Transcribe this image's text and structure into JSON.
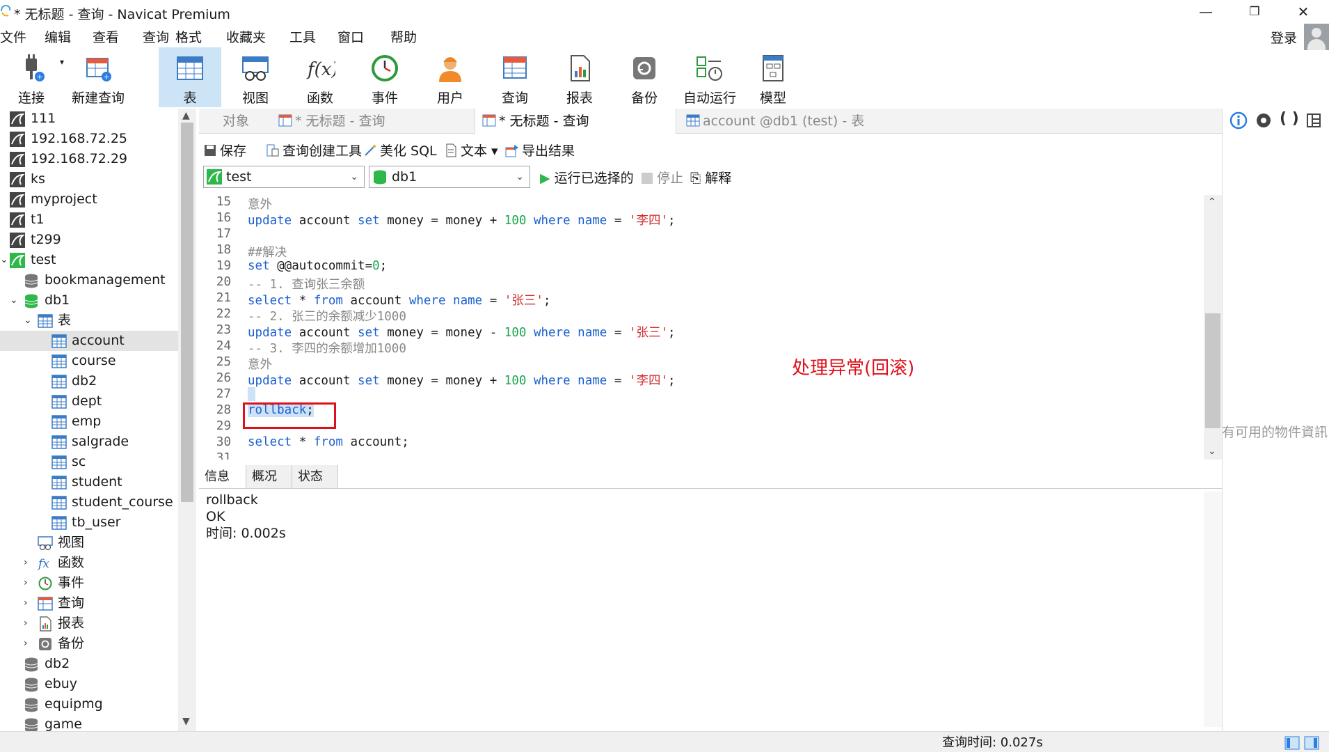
{
  "window": {
    "title": "* 无标题 - 查询 - Navicat Premium",
    "minimize": "—",
    "restore": "❐",
    "close": "✕"
  },
  "menu": [
    "文件",
    "编辑",
    "查看",
    "查询",
    "格式",
    "收藏夹",
    "工具",
    "窗口",
    "帮助"
  ],
  "login": "登录",
  "toolbar": [
    {
      "label": "连接",
      "icon": "plug-icon"
    },
    {
      "label": "新建查询",
      "icon": "new-query-icon"
    },
    {
      "label": "表",
      "icon": "table-icon"
    },
    {
      "label": "视图",
      "icon": "view-icon"
    },
    {
      "label": "函数",
      "icon": "function-icon"
    },
    {
      "label": "事件",
      "icon": "event-clock-icon"
    },
    {
      "label": "用户",
      "icon": "user-icon"
    },
    {
      "label": "查询",
      "icon": "query-icon"
    },
    {
      "label": "报表",
      "icon": "report-icon"
    },
    {
      "label": "备份",
      "icon": "backup-icon"
    },
    {
      "label": "自动运行",
      "icon": "automation-icon"
    },
    {
      "label": "模型",
      "icon": "model-icon"
    }
  ],
  "tree": [
    {
      "label": "111",
      "type": "conn"
    },
    {
      "label": "192.168.72.25",
      "type": "conn"
    },
    {
      "label": "192.168.72.29",
      "type": "conn"
    },
    {
      "label": "ks",
      "type": "conn"
    },
    {
      "label": "myproject",
      "type": "conn"
    },
    {
      "label": "t1",
      "type": "conn"
    },
    {
      "label": "t299",
      "type": "conn"
    },
    {
      "label": "test",
      "type": "conn-open"
    },
    {
      "label": "bookmanagement",
      "type": "db"
    },
    {
      "label": "db1",
      "type": "db-open"
    },
    {
      "label": "表",
      "type": "folder-table"
    },
    {
      "label": "account",
      "type": "table"
    },
    {
      "label": "course",
      "type": "table"
    },
    {
      "label": "db2",
      "type": "table"
    },
    {
      "label": "dept",
      "type": "table"
    },
    {
      "label": "emp",
      "type": "table"
    },
    {
      "label": "salgrade",
      "type": "table"
    },
    {
      "label": "sc",
      "type": "table"
    },
    {
      "label": "student",
      "type": "table"
    },
    {
      "label": "student_course",
      "type": "table"
    },
    {
      "label": "tb_user",
      "type": "table"
    },
    {
      "label": "视图",
      "type": "folder-view"
    },
    {
      "label": "函数",
      "type": "folder-func"
    },
    {
      "label": "事件",
      "type": "folder-event"
    },
    {
      "label": "查询",
      "type": "folder-query"
    },
    {
      "label": "报表",
      "type": "folder-report"
    },
    {
      "label": "备份",
      "type": "folder-backup"
    },
    {
      "label": "db2",
      "type": "db"
    },
    {
      "label": "ebuy",
      "type": "db"
    },
    {
      "label": "equipmg",
      "type": "db"
    },
    {
      "label": "game",
      "type": "db"
    }
  ],
  "tabs": [
    {
      "label": "对象"
    },
    {
      "label": "* 无标题 - 查询"
    },
    {
      "label": "* 无标题 - 查询"
    },
    {
      "label": "account @db1 (test) - 表"
    }
  ],
  "qtoolbar": [
    "保存",
    "查询创建工具",
    "美化 SQL",
    "文本",
    "导出结果",
    "运行已选择的",
    "停止",
    "解释"
  ],
  "connection_select": "test",
  "database_select": "db1",
  "annotation": "处理异常(回滚)",
  "bottom_tabs": [
    "信息",
    "概况",
    "状态"
  ],
  "result_lines": [
    "rollback",
    "OK",
    "时间: 0.002s"
  ],
  "right_panel_text": "有可用的物件資訊",
  "status_time": "查询时间: 0.027s"
}
